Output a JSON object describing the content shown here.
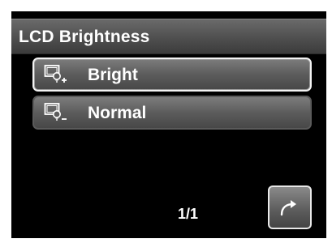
{
  "title": "LCD Brightness",
  "menu": {
    "items": [
      {
        "label": "Bright",
        "icon": "lcd-bright-plus-icon",
        "selected": true
      },
      {
        "label": "Normal",
        "icon": "lcd-brightness-minus-icon",
        "selected": false
      }
    ]
  },
  "pagination": {
    "text": "1/1"
  },
  "buttons": {
    "return_icon": "return-arrow-icon"
  },
  "colors": {
    "background": "#000000",
    "bar": "#555555",
    "text": "#ffffff",
    "selection_border": "#f2f2f2"
  }
}
